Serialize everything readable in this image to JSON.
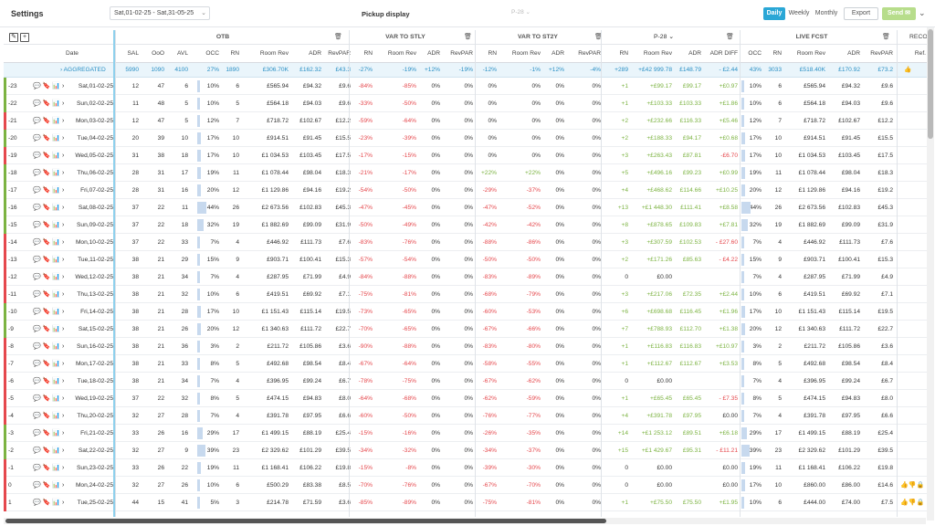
{
  "topbar": {
    "title": "Settings",
    "date_range": "Sat,01-02-25 - Sat,31-05-25",
    "pickup_label": "Pickup display",
    "pickup_select": "P-28",
    "view_daily": "Daily",
    "view_weekly": "Weekly",
    "view_monthly": "Monthly",
    "export_label": "Export",
    "send_label": "Send"
  },
  "groups": {
    "otb": "OTB",
    "var_stly": "VAR TO STLY",
    "var_st2y": "VAR TO ST2Y",
    "p28": "P-28",
    "live_fcst": "LIVE FCST",
    "reco": "RECO"
  },
  "columns": {
    "date": "Date",
    "otb": [
      "SAL",
      "OoO",
      "AVL",
      "OCC",
      "RN",
      "Room Rev",
      "ADR",
      "RevPAR"
    ],
    "var_stly": [
      "RN",
      "Room Rev",
      "ADR",
      "RevPAR"
    ],
    "var_st2y": [
      "RN",
      "Room Rev",
      "ADR",
      "RevPAR"
    ],
    "p28": [
      "RN",
      "Room Rev",
      "ADR",
      "ADR DIFF"
    ],
    "fcst": [
      "OCC",
      "RN",
      "Room Rev",
      "ADR",
      "RevPAR"
    ],
    "reco": "Ref."
  },
  "aggregated": {
    "label": "AGGREGATED",
    "otb": [
      "5990",
      "1090",
      "4100",
      "27%",
      "1890",
      "£306.70K",
      "£162.32",
      "£43.3"
    ],
    "stly": [
      "-27%",
      "-19%",
      "+12%",
      "-19%"
    ],
    "st2y": [
      "-12%",
      "-1%",
      "+12%",
      "-4%"
    ],
    "p28": [
      "+289",
      "+£42 999.78",
      "£148.79",
      "- £2.44"
    ],
    "fcst": [
      "43%",
      "3033",
      "£518.40K",
      "£170.92",
      "£73.2"
    ]
  },
  "colors": {
    "accent": "#2aa7d6",
    "negative": "#e5484d",
    "positive": "#7cb342",
    "send": "#b7dd8b"
  },
  "rows": [
    {
      "lead": "-23",
      "date": "Sat,01-02-25",
      "otb": [
        "12",
        "47",
        "6",
        "10%",
        "6",
        "£565.94",
        "£94.32",
        "£9.6"
      ],
      "stly": [
        "-84%",
        "-85%",
        "0%",
        "0%"
      ],
      "st2y": [
        "0%",
        "0%",
        "0%",
        "0%"
      ],
      "p28": [
        "+1",
        "+£99.17",
        "£99.17",
        "+£0.97"
      ],
      "fcst": [
        "10%",
        "6",
        "£565.94",
        "£94.32",
        "£9.6"
      ],
      "occ": 0.1,
      "fc_occ": 0.1,
      "lvl": "#7cb342"
    },
    {
      "lead": "-22",
      "date": "Sun,02-02-25",
      "otb": [
        "11",
        "48",
        "5",
        "10%",
        "5",
        "£564.18",
        "£94.03",
        "£9.6"
      ],
      "stly": [
        "-33%",
        "-50%",
        "0%",
        "0%"
      ],
      "st2y": [
        "0%",
        "0%",
        "0%",
        "0%"
      ],
      "p28": [
        "+1",
        "+£103.33",
        "£103.33",
        "+£1.86"
      ],
      "fcst": [
        "10%",
        "6",
        "£564.18",
        "£94.03",
        "£9.6"
      ],
      "occ": 0.1,
      "fc_occ": 0.1,
      "lvl": "#7cb342"
    },
    {
      "lead": "-21",
      "date": "Mon,03-02-25",
      "otb": [
        "12",
        "47",
        "5",
        "12%",
        "7",
        "£718.72",
        "£102.67",
        "£12.2"
      ],
      "stly": [
        "-59%",
        "-64%",
        "0%",
        "0%"
      ],
      "st2y": [
        "0%",
        "0%",
        "0%",
        "0%"
      ],
      "p28": [
        "+2",
        "+£232.66",
        "£116.33",
        "+£5.46"
      ],
      "fcst": [
        "12%",
        "7",
        "£718.72",
        "£102.67",
        "£12.2"
      ],
      "occ": 0.12,
      "fc_occ": 0.12,
      "lvl": "#e5484d"
    },
    {
      "lead": "-20",
      "date": "Tue,04-02-25",
      "otb": [
        "20",
        "39",
        "10",
        "17%",
        "10",
        "£914.51",
        "£91.45",
        "£15.5"
      ],
      "stly": [
        "-23%",
        "-39%",
        "0%",
        "0%"
      ],
      "st2y": [
        "0%",
        "0%",
        "0%",
        "0%"
      ],
      "p28": [
        "+2",
        "+£188.33",
        "£94.17",
        "+£0.68"
      ],
      "fcst": [
        "17%",
        "10",
        "£914.51",
        "£91.45",
        "£15.5"
      ],
      "occ": 0.17,
      "fc_occ": 0.17,
      "lvl": "#7cb342"
    },
    {
      "lead": "-19",
      "date": "Wed,05-02-25",
      "otb": [
        "31",
        "38",
        "18",
        "17%",
        "10",
        "£1 034.53",
        "£103.45",
        "£17.5"
      ],
      "stly": [
        "-17%",
        "-15%",
        "0%",
        "0%"
      ],
      "st2y": [
        "0%",
        "0%",
        "0%",
        "0%"
      ],
      "p28": [
        "+3",
        "+£263.43",
        "£87.81",
        "-£6.70"
      ],
      "fcst": [
        "17%",
        "10",
        "£1 034.53",
        "£103.45",
        "£17.5"
      ],
      "occ": 0.17,
      "fc_occ": 0.17,
      "lvl": "#e5484d"
    },
    {
      "lead": "-18",
      "date": "Thu,06-02-25",
      "otb": [
        "28",
        "31",
        "17",
        "19%",
        "11",
        "£1 078.44",
        "£98.04",
        "£18.3"
      ],
      "stly": [
        "-21%",
        "-17%",
        "0%",
        "0%"
      ],
      "st2y": [
        "+22%",
        "+22%",
        "0%",
        "0%"
      ],
      "p28": [
        "+5",
        "+£496.16",
        "£99.23",
        "+£0.99"
      ],
      "fcst": [
        "19%",
        "11",
        "£1 078.44",
        "£98.04",
        "£18.3"
      ],
      "occ": 0.19,
      "fc_occ": 0.19,
      "lvl": "#7cb342"
    },
    {
      "lead": "-17",
      "date": "Fri,07-02-25",
      "otb": [
        "28",
        "31",
        "16",
        "20%",
        "12",
        "£1 129.86",
        "£94.16",
        "£19.2"
      ],
      "stly": [
        "-54%",
        "-50%",
        "0%",
        "0%"
      ],
      "st2y": [
        "-29%",
        "-37%",
        "0%",
        "0%"
      ],
      "p28": [
        "+4",
        "+£468.62",
        "£114.66",
        "+£10.25"
      ],
      "fcst": [
        "20%",
        "12",
        "£1 129.86",
        "£94.16",
        "£19.2"
      ],
      "occ": 0.2,
      "fc_occ": 0.2,
      "lvl": "#7cb342"
    },
    {
      "lead": "-16",
      "date": "Sat,08-02-25",
      "otb": [
        "22",
        "11",
        "44%",
        "26",
        "£2 673.56",
        "£102.83",
        "£45.3"
      ],
      "stly": [
        "-47%",
        "-45%",
        "0%",
        "0%"
      ],
      "st2y": [
        "-47%",
        "-52%",
        "0%",
        "0%"
      ],
      "p28": [
        "+13",
        "+£1 448.30",
        "£111.41",
        "+£8.58"
      ],
      "fcst": [
        "44%",
        "26",
        "£2 673.56",
        "£102.83",
        "£45.3"
      ],
      "occ": 0.44,
      "fc_occ": 0.44,
      "lvl": "#7cb342",
      "sal": "37"
    },
    {
      "lead": "-15",
      "date": "Sun,09-02-25",
      "otb": [
        "37",
        "22",
        "18",
        "32%",
        "19",
        "£1 882.69",
        "£99.09",
        "£31.9"
      ],
      "stly": [
        "-50%",
        "-49%",
        "0%",
        "0%"
      ],
      "st2y": [
        "-42%",
        "-42%",
        "0%",
        "0%"
      ],
      "p28": [
        "+8",
        "+£878.65",
        "£109.83",
        "+£7.81"
      ],
      "fcst": [
        "32%",
        "19",
        "£1 882.69",
        "£99.09",
        "£31.9"
      ],
      "occ": 0.32,
      "fc_occ": 0.32,
      "lvl": "#7cb342"
    },
    {
      "lead": "-14",
      "date": "Mon,10-02-25",
      "otb": [
        "37",
        "22",
        "33",
        "7%",
        "4",
        "£446.92",
        "£111.73",
        "£7.6"
      ],
      "stly": [
        "-83%",
        "-76%",
        "0%",
        "0%"
      ],
      "st2y": [
        "-88%",
        "-86%",
        "0%",
        "0%"
      ],
      "p28": [
        "+3",
        "+£307.59",
        "£102.53",
        "- £27.60"
      ],
      "fcst": [
        "7%",
        "4",
        "£446.92",
        "£111.73",
        "£7.6"
      ],
      "occ": 0.07,
      "fc_occ": 0.07,
      "lvl": "#e5484d"
    },
    {
      "lead": "-13",
      "date": "Tue,11-02-25",
      "otb": [
        "38",
        "21",
        "29",
        "15%",
        "9",
        "£903.71",
        "£100.41",
        "£15.3"
      ],
      "stly": [
        "-57%",
        "-54%",
        "0%",
        "0%"
      ],
      "st2y": [
        "-50%",
        "-50%",
        "0%",
        "0%"
      ],
      "p28": [
        "+2",
        "+£171.26",
        "£85.63",
        "- £4.22"
      ],
      "fcst": [
        "15%",
        "9",
        "£903.71",
        "£100.41",
        "£15.3"
      ],
      "occ": 0.15,
      "fc_occ": 0.15,
      "lvl": "#e5484d"
    },
    {
      "lead": "-12",
      "date": "Wed,12-02-25",
      "otb": [
        "38",
        "21",
        "34",
        "7%",
        "4",
        "£287.95",
        "£71.99",
        "£4.9"
      ],
      "stly": [
        "-84%",
        "-88%",
        "0%",
        "0%"
      ],
      "st2y": [
        "-83%",
        "-89%",
        "0%",
        "0%"
      ],
      "p28": [
        "0",
        "£0.00",
        "",
        ""
      ],
      "fcst": [
        "7%",
        "4",
        "£287.95",
        "£71.99",
        "£4.9"
      ],
      "occ": 0.07,
      "fc_occ": 0.07,
      "lvl": "#e5484d"
    },
    {
      "lead": "-11",
      "date": "Thu,13-02-25",
      "otb": [
        "38",
        "21",
        "32",
        "10%",
        "6",
        "£419.51",
        "£69.92",
        "£7.1"
      ],
      "stly": [
        "-75%",
        "-81%",
        "0%",
        "0%"
      ],
      "st2y": [
        "-68%",
        "-79%",
        "0%",
        "0%"
      ],
      "p28": [
        "+3",
        "+£217.06",
        "£72.35",
        "+£2.44"
      ],
      "fcst": [
        "10%",
        "6",
        "£419.51",
        "£69.92",
        "£7.1"
      ],
      "occ": 0.1,
      "fc_occ": 0.1,
      "lvl": "#e5484d"
    },
    {
      "lead": "-10",
      "date": "Fri,14-02-25",
      "otb": [
        "38",
        "21",
        "28",
        "17%",
        "10",
        "£1 151.43",
        "£115.14",
        "£19.5"
      ],
      "stly": [
        "-73%",
        "-65%",
        "0%",
        "0%"
      ],
      "st2y": [
        "-60%",
        "-53%",
        "0%",
        "0%"
      ],
      "p28": [
        "+6",
        "+£698.68",
        "£116.45",
        "+£1.96"
      ],
      "fcst": [
        "17%",
        "10",
        "£1 151.43",
        "£115.14",
        "£19.5"
      ],
      "occ": 0.17,
      "fc_occ": 0.17,
      "lvl": "#7cb342"
    },
    {
      "lead": "-9",
      "date": "Sat,15-02-25",
      "otb": [
        "38",
        "21",
        "26",
        "20%",
        "12",
        "£1 340.63",
        "£111.72",
        "£22.7"
      ],
      "stly": [
        "-70%",
        "-65%",
        "0%",
        "0%"
      ],
      "st2y": [
        "-67%",
        "-66%",
        "0%",
        "0%"
      ],
      "p28": [
        "+7",
        "+£788.93",
        "£112.70",
        "+£1.38"
      ],
      "fcst": [
        "20%",
        "12",
        "£1 340.63",
        "£111.72",
        "£22.7"
      ],
      "occ": 0.2,
      "fc_occ": 0.2,
      "lvl": "#7cb342"
    },
    {
      "lead": "-8",
      "date": "Sun,16-02-25",
      "otb": [
        "38",
        "21",
        "36",
        "3%",
        "2",
        "£211.72",
        "£105.86",
        "£3.6"
      ],
      "stly": [
        "-90%",
        "-88%",
        "0%",
        "0%"
      ],
      "st2y": [
        "-83%",
        "-80%",
        "0%",
        "0%"
      ],
      "p28": [
        "+1",
        "+£116.83",
        "£116.83",
        "+£10.97"
      ],
      "fcst": [
        "3%",
        "2",
        "£211.72",
        "£105.86",
        "£3.6"
      ],
      "occ": 0.03,
      "fc_occ": 0.03,
      "lvl": "#e5484d"
    },
    {
      "lead": "-7",
      "date": "Mon,17-02-25",
      "otb": [
        "38",
        "21",
        "33",
        "8%",
        "5",
        "£492.68",
        "£98.54",
        "£8.4"
      ],
      "stly": [
        "-67%",
        "-64%",
        "0%",
        "0%"
      ],
      "st2y": [
        "-58%",
        "-55%",
        "0%",
        "0%"
      ],
      "p28": [
        "+1",
        "+£112.67",
        "£112.67",
        "+£3.53"
      ],
      "fcst": [
        "8%",
        "5",
        "£492.68",
        "£98.54",
        "£8.4"
      ],
      "occ": 0.08,
      "fc_occ": 0.08,
      "lvl": "#e5484d"
    },
    {
      "lead": "-6",
      "date": "Tue,18-02-25",
      "otb": [
        "38",
        "21",
        "34",
        "7%",
        "4",
        "£396.95",
        "£99.24",
        "£6.7"
      ],
      "stly": [
        "-78%",
        "-75%",
        "0%",
        "0%"
      ],
      "st2y": [
        "-67%",
        "-62%",
        "0%",
        "0%"
      ],
      "p28": [
        "0",
        "£0.00",
        "",
        ""
      ],
      "fcst": [
        "7%",
        "4",
        "£396.95",
        "£99.24",
        "£6.7"
      ],
      "occ": 0.07,
      "fc_occ": 0.07,
      "lvl": "#e5484d"
    },
    {
      "lead": "-5",
      "date": "Wed,19-02-25",
      "otb": [
        "37",
        "22",
        "32",
        "8%",
        "5",
        "£474.15",
        "£94.83",
        "£8.0"
      ],
      "stly": [
        "-64%",
        "-68%",
        "0%",
        "0%"
      ],
      "st2y": [
        "-62%",
        "-59%",
        "0%",
        "0%"
      ],
      "p28": [
        "+1",
        "+£65.45",
        "£65.45",
        "- £7.35"
      ],
      "fcst": [
        "8%",
        "5",
        "£474.15",
        "£94.83",
        "£8.0"
      ],
      "occ": 0.08,
      "fc_occ": 0.08,
      "lvl": "#e5484d"
    },
    {
      "lead": "-4",
      "date": "Thu,20-02-25",
      "otb": [
        "32",
        "27",
        "28",
        "7%",
        "4",
        "£391.78",
        "£97.95",
        "£6.6"
      ],
      "stly": [
        "-60%",
        "-50%",
        "0%",
        "0%"
      ],
      "st2y": [
        "-76%",
        "-77%",
        "0%",
        "0%"
      ],
      "p28": [
        "+4",
        "+£391.78",
        "£97.95",
        "£0.00"
      ],
      "fcst": [
        "7%",
        "4",
        "£391.78",
        "£97.95",
        "£6.6"
      ],
      "occ": 0.07,
      "fc_occ": 0.07,
      "lvl": "#e5484d"
    },
    {
      "lead": "-3",
      "date": "Fri,21-02-25",
      "otb": [
        "33",
        "26",
        "16",
        "29%",
        "17",
        "£1 499.15",
        "£88.19",
        "£25.4"
      ],
      "stly": [
        "-15%",
        "-16%",
        "0%",
        "0%"
      ],
      "st2y": [
        "-26%",
        "-35%",
        "0%",
        "0%"
      ],
      "p28": [
        "+14",
        "+£1 253.12",
        "£89.51",
        "+£6.18"
      ],
      "fcst": [
        "29%",
        "17",
        "£1 499.15",
        "£88.19",
        "£25.4"
      ],
      "occ": 0.29,
      "fc_occ": 0.29,
      "lvl": "#7cb342"
    },
    {
      "lead": "-2",
      "date": "Sat,22-02-25",
      "otb": [
        "32",
        "27",
        "9",
        "39%",
        "23",
        "£2 329.62",
        "£101.29",
        "£39.5"
      ],
      "stly": [
        "-34%",
        "-32%",
        "0%",
        "0%"
      ],
      "st2y": [
        "-34%",
        "-37%",
        "0%",
        "0%"
      ],
      "p28": [
        "+15",
        "+£1 429.67",
        "£95.31",
        "- £11.21"
      ],
      "fcst": [
        "39%",
        "23",
        "£2 329.62",
        "£101.29",
        "£39.5"
      ],
      "occ": 0.39,
      "fc_occ": 0.39,
      "lvl": "#7cb342"
    },
    {
      "lead": "-1",
      "date": "Sun,23-02-25",
      "otb": [
        "33",
        "26",
        "22",
        "19%",
        "11",
        "£1 168.41",
        "£106.22",
        "£19.8"
      ],
      "stly": [
        "-15%",
        "-8%",
        "0%",
        "0%"
      ],
      "st2y": [
        "-39%",
        "-30%",
        "0%",
        "0%"
      ],
      "p28": [
        "0",
        "£0.00",
        "",
        "£0.00"
      ],
      "fcst": [
        "19%",
        "11",
        "£1 168.41",
        "£106.22",
        "£19.8"
      ],
      "occ": 0.19,
      "fc_occ": 0.19,
      "lvl": "#e5484d"
    },
    {
      "lead": "0",
      "date": "Mon,24-02-25",
      "otb": [
        "32",
        "27",
        "26",
        "10%",
        "6",
        "£500.29",
        "£83.38",
        "£8.5"
      ],
      "stly": [
        "-70%",
        "-76%",
        "0%",
        "0%"
      ],
      "st2y": [
        "-67%",
        "-70%",
        "0%",
        "0%"
      ],
      "p28": [
        "0",
        "£0.00",
        "",
        "£0.00"
      ],
      "fcst": [
        "17%",
        "10",
        "£860.00",
        "£86.00",
        "£14.6"
      ],
      "occ": 0.1,
      "fc_occ": 0.17,
      "lvl": "#e5484d"
    },
    {
      "lead": "1",
      "date": "Tue,25-02-25",
      "otb": [
        "44",
        "15",
        "41",
        "5%",
        "3",
        "£214.78",
        "£71.59",
        "£3.6"
      ],
      "stly": [
        "-85%",
        "-89%",
        "0%",
        "0%"
      ],
      "st2y": [
        "-75%",
        "-81%",
        "0%",
        "0%"
      ],
      "p28": [
        "+1",
        "+£75.50",
        "£75.50",
        "+£1.95"
      ],
      "fcst": [
        "10%",
        "6",
        "£444.00",
        "£74.00",
        "£7.5"
      ],
      "occ": 0.05,
      "fc_occ": 0.1,
      "lvl": "#e5484d"
    }
  ]
}
